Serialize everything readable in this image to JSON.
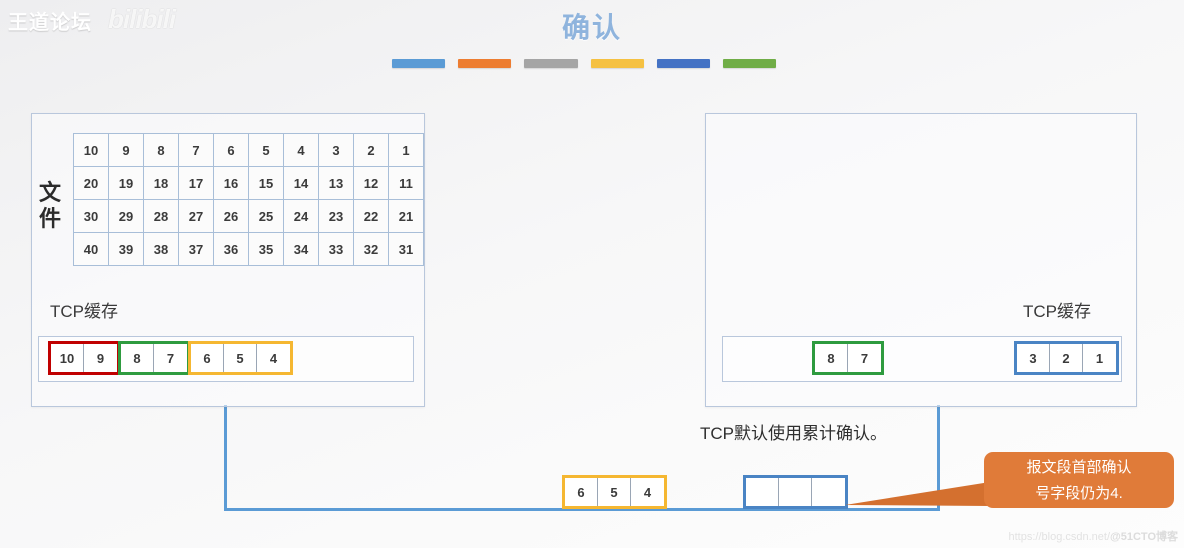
{
  "watermarks": {
    "top_left": "王道论坛",
    "top_left_logo": "bilibili",
    "bottom_right_url": "https://blog.csdn.net/",
    "bottom_right_author": "@51CTO博客"
  },
  "header": {
    "title": "确认",
    "title_color": "#8fb4dd",
    "rule_bar_colors": [
      "#5b9bd5",
      "#ed7d31",
      "#a5a5a5",
      "#f5c142",
      "#4472c4",
      "#70ad47"
    ]
  },
  "left_panel": {
    "file_label": "文件",
    "grid": {
      "rows": [
        [
          "10",
          "9",
          "8",
          "7",
          "6",
          "5",
          "4",
          "3",
          "2",
          "1"
        ],
        [
          "20",
          "19",
          "18",
          "17",
          "16",
          "15",
          "14",
          "13",
          "12",
          "11"
        ],
        [
          "30",
          "29",
          "28",
          "27",
          "26",
          "25",
          "24",
          "23",
          "22",
          "21"
        ],
        [
          "40",
          "39",
          "38",
          "37",
          "36",
          "35",
          "34",
          "33",
          "32",
          "31"
        ]
      ]
    },
    "buffer_caption": "TCP缓存",
    "buffer_groups": [
      {
        "color": "#c00000",
        "cells": [
          "10",
          "9"
        ]
      },
      {
        "color": "#2e9b3f",
        "cells": [
          "8",
          "7"
        ]
      },
      {
        "color": "#f5b731",
        "cells": [
          "6",
          "5",
          "4"
        ]
      }
    ]
  },
  "right_panel": {
    "buffer_caption": "TCP缓存",
    "buffer_groups": [
      {
        "color": "#2e9b3f",
        "cells": [
          "8",
          "7"
        ]
      },
      {
        "color": "#4a84c4",
        "cells": [
          "3",
          "2",
          "1"
        ]
      }
    ]
  },
  "bottom": {
    "note": "TCP默认使用累计确认。",
    "sent_segment": {
      "color": "#f5b731",
      "cells": [
        "6",
        "5",
        "4"
      ]
    },
    "received_segment": {
      "color": "#4a84c4",
      "cells": [
        "",
        "",
        ""
      ]
    },
    "callout": {
      "color": "#e07b39",
      "line1": "报文段首部确认",
      "line2": "号字段仍为4."
    }
  },
  "connectors": {
    "line_color": "#5b9bd5"
  }
}
